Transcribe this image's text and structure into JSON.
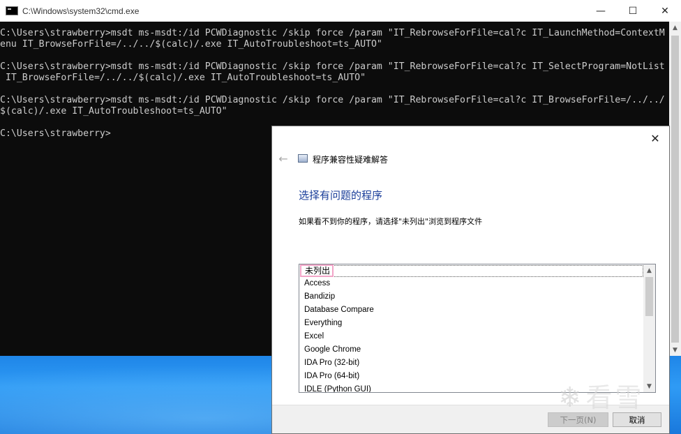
{
  "cmd": {
    "title": "C:\\Windows\\system32\\cmd.exe",
    "lines": [
      "C:\\Users\\strawberry>msdt ms-msdt:/id PCWDiagnostic /skip force /param \"IT_RebrowseForFile=cal?c IT_LaunchMethod=ContextM",
      "enu IT_BrowseForFile=/../../$(calc)/.exe IT_AutoTroubleshoot=ts_AUTO\"",
      "",
      "C:\\Users\\strawberry>msdt ms-msdt:/id PCWDiagnostic /skip force /param \"IT_RebrowseForFile=cal?c IT_SelectProgram=NotList",
      " IT_BrowseForFile=/../../$(calc)/.exe IT_AutoTroubleshoot=ts_AUTO\"",
      "",
      "C:\\Users\\strawberry>msdt ms-msdt:/id PCWDiagnostic /skip force /param \"IT_RebrowseForFile=cal?c IT_BrowseForFile=/../../",
      "$(calc)/.exe IT_AutoTroubleshoot=ts_AUTO\"",
      "",
      "C:\\Users\\strawberry>"
    ],
    "window_buttons": {
      "minimize": "—",
      "maximize": "☐",
      "close": "✕"
    }
  },
  "dialog": {
    "app_title": "程序兼容性疑难解答",
    "heading": "选择有问题的程序",
    "description": "如果看不到你的程序，请选择\"未列出\"浏览到程序文件",
    "close_glyph": "✕",
    "back_glyph": "←",
    "programs": [
      "未列出",
      "Access",
      "Bandizip",
      "Database Compare",
      "Everything",
      "Excel",
      "Google Chrome",
      "IDA Pro (32-bit)",
      "IDA Pro (64-bit)",
      "IDLE (Python GUI)"
    ],
    "selected_index": 0,
    "buttons": {
      "next": "下一页(N)",
      "cancel": "取消"
    }
  },
  "watermark": {
    "text": "看雪"
  },
  "colors": {
    "heading_blue": "#1a3e9a",
    "highlight_pink": "#f2a5c8",
    "console_bg": "#0c0c0c",
    "console_fg": "#cccccc"
  }
}
